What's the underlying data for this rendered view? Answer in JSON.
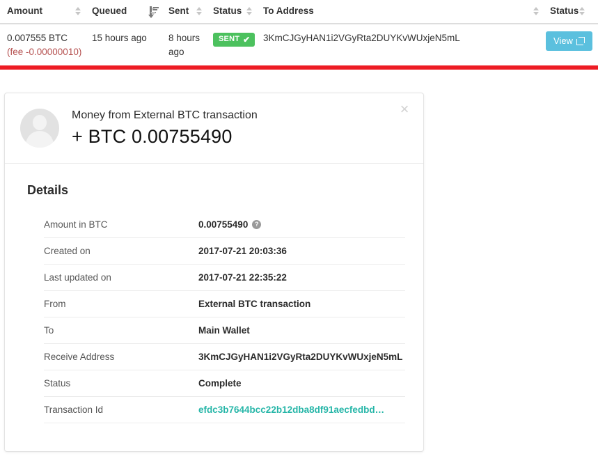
{
  "table": {
    "columns": [
      {
        "label": "Amount",
        "sort_icon": "sort-both-icon"
      },
      {
        "label": "Queued",
        "sort_icon": "sort-amount-desc-icon"
      },
      {
        "label": "Sent",
        "sort_icon": "sort-both-icon"
      },
      {
        "label": "Status",
        "sort_icon": "sort-both-icon"
      },
      {
        "label": "To Address",
        "sort_icon": "sort-both-icon"
      },
      {
        "label": "Status",
        "sort_icon": "sort-both-icon"
      }
    ],
    "row": {
      "amount": "0.007555 BTC",
      "fee": "(fee -0.00000010)",
      "queued": "15 hours ago",
      "sent": "8 hours ago",
      "status_badge": "SENT",
      "status_badge_check": "✔",
      "to_address": "3KmCJGyHAN1i2VGyRta2DUYKvWUxjeN5mL",
      "action_label": "View",
      "action_icon": "external-link-icon"
    }
  },
  "modal": {
    "close_label": "×",
    "avatar_icon": "user-avatar-icon",
    "subtitle": "Money from External BTC transaction",
    "amount": "+ BTC 0.00755490",
    "details_title": "Details",
    "details": [
      {
        "label": "Amount in BTC",
        "value": "0.00755490",
        "help_icon": "?",
        "link": false
      },
      {
        "label": "Created on",
        "value": "2017-07-21 20:03:36",
        "link": false
      },
      {
        "label": "Last updated on",
        "value": "2017-07-21 22:35:22",
        "link": false
      },
      {
        "label": "From",
        "value": "External BTC transaction",
        "link": false
      },
      {
        "label": "To",
        "value": "Main Wallet",
        "link": false
      },
      {
        "label": "Receive Address",
        "value": "3KmCJGyHAN1i2VGyRta2DUYKvWUxjeN5mL",
        "link": false
      },
      {
        "label": "Status",
        "value": "Complete",
        "link": false
      },
      {
        "label": "Transaction Id",
        "value": "efdc3b7644bcc22b12dba8df91aecfedbd…",
        "link": true
      }
    ]
  },
  "colors": {
    "accent_red_bar": "#ed1c24",
    "badge_green": "#4cc15e",
    "button_blue": "#5bc0de",
    "link_teal": "#26b6a8",
    "fee_red": "#b5504f"
  }
}
